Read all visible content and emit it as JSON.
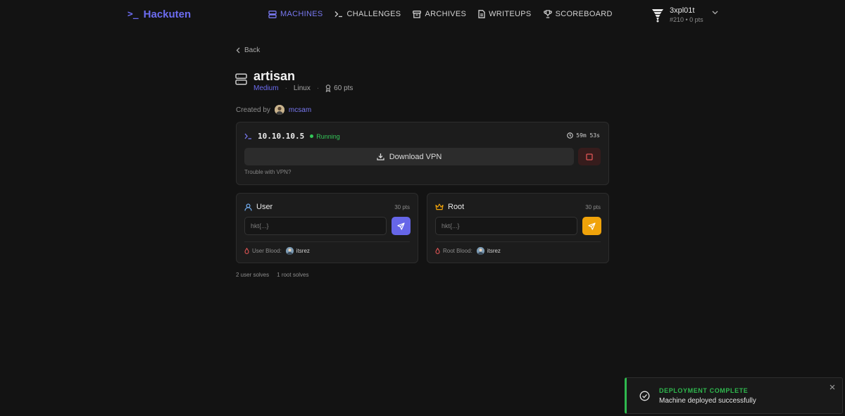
{
  "brand": {
    "prompt": ">_",
    "name": "Hackuten",
    "accent": "#6c6cf0"
  },
  "nav": {
    "items": [
      {
        "label": "MACHINES",
        "icon": "server-icon",
        "active": true
      },
      {
        "label": "CHALLENGES",
        "icon": "terminal-icon"
      },
      {
        "label": "ARCHIVES",
        "icon": "archive-icon"
      },
      {
        "label": "WRITEUPS",
        "icon": "document-icon"
      },
      {
        "label": "SCOREBOARD",
        "icon": "trophy-icon"
      }
    ]
  },
  "user": {
    "name": "3xpl01t",
    "rank": "#210 • 0 pts",
    "avatar_icon": "tornado-icon"
  },
  "back_label": "Back",
  "machine": {
    "name": "artisan",
    "difficulty": "Medium",
    "os": "Linux",
    "points": "60 pts",
    "created_by_label": "Created by",
    "creator": "mcsam"
  },
  "instance": {
    "ip": "10.10.10.5",
    "status": "Running",
    "timer": "59m 53s",
    "vpn_button": "Download VPN",
    "trouble_link": "Trouble with VPN?"
  },
  "flags": {
    "user": {
      "title": "User",
      "points": "30 pts",
      "placeholder": "hkt{...}",
      "blood_label": "User Blood:",
      "blood_user": "itsrez",
      "color": "#6666e8"
    },
    "root": {
      "title": "Root",
      "points": "30 pts",
      "placeholder": "hkt{...}",
      "blood_label": "Root Blood:",
      "blood_user": "itsrez",
      "color": "#f0a30a"
    }
  },
  "solves": {
    "user": "2 user solves",
    "root": "1 root solves"
  },
  "toast": {
    "title": "DEPLOYMENT COMPLETE",
    "message": "Machine deployed successfully",
    "color": "#2fb94e"
  }
}
